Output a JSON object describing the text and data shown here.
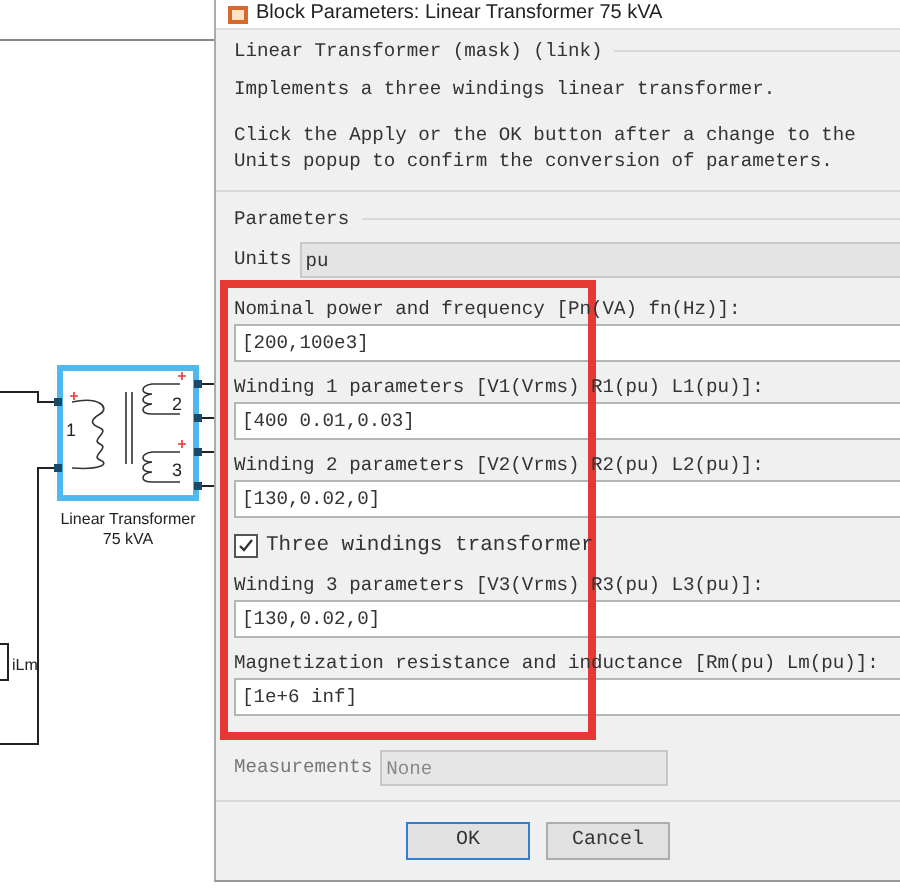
{
  "window": {
    "title": "Block Parameters: Linear Transformer 75 kVA"
  },
  "diagram": {
    "block": {
      "name": "Linear Transformer",
      "subtitle": "75 kVA",
      "ports": [
        "1",
        "2",
        "3"
      ],
      "selected": true
    },
    "probe": {
      "label": "iLm"
    }
  },
  "mask": {
    "heading": "Linear Transformer (mask) (link)",
    "description": "Implements a three windings linear transformer.",
    "note": "Click the Apply or the OK button after a change to the Units popup to confirm the conversion of parameters."
  },
  "parameters": {
    "heading": "Parameters",
    "units": {
      "label": "Units",
      "value": "pu"
    },
    "fields": [
      {
        "kind": "text",
        "label": "Nominal power and frequency [Pn(VA) fn(Hz)]:",
        "value": "[200,100e3]"
      },
      {
        "kind": "text",
        "label": "Winding 1 parameters [V1(Vrms) R1(pu) L1(pu)]:",
        "value": "[400 0.01,0.03]"
      },
      {
        "kind": "text",
        "label": "Winding 2 parameters [V2(Vrms) R2(pu) L2(pu)]:",
        "value": "[130,0.02,0]"
      },
      {
        "kind": "checkbox",
        "label": "Three windings transformer",
        "checked": true
      },
      {
        "kind": "text",
        "label": "Winding 3 parameters [V3(Vrms) R3(pu) L3(pu)]:",
        "value": "[130,0.02,0]"
      },
      {
        "kind": "text",
        "label": "Magnetization resistance and inductance [Rm(pu) Lm(pu)]:",
        "value": "[1e+6 inf]"
      }
    ],
    "measurements": {
      "label": "Measurements",
      "value": "None"
    }
  },
  "buttons": [
    {
      "label": "OK",
      "default": true
    },
    {
      "label": "Cancel",
      "default": false
    }
  ],
  "highlight": {
    "kind": "frame"
  }
}
